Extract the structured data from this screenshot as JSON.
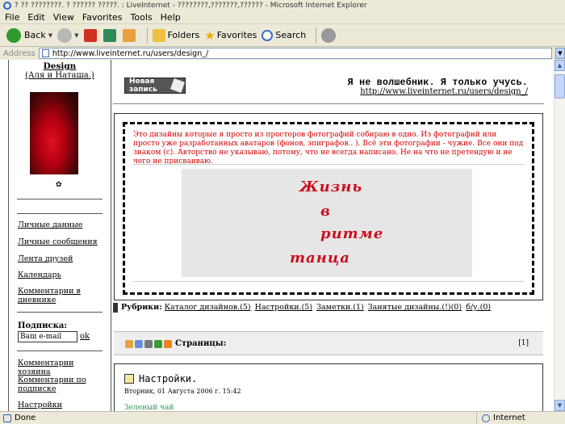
{
  "window": {
    "title": "? ?? ????????. ? ?????? ?????. : LiveInternet - ????????,???????,?????? - Microsoft Internet Explorer"
  },
  "menu": [
    "File",
    "Edit",
    "View",
    "Favorites",
    "Tools",
    "Help"
  ],
  "toolbar": {
    "back": "Back",
    "folders": "Folders",
    "favorites": "Favorites",
    "search": "Search"
  },
  "address": {
    "label": "Address",
    "url": "http://www.liveinternet.ru/users/design_/"
  },
  "sidebar": {
    "title": "Design",
    "authors": "(Аля и Наташа.)",
    "avatar_mark": "✿",
    "links": [
      "Личные данные",
      "Личные сообщения",
      "Лента друзей",
      "Календарь",
      "Комментарии в дневнике"
    ],
    "subscribe_label": "Подписка:",
    "email_value": "Ваш e-mail",
    "ok": "ok",
    "links2": [
      "Комментарии хозяина",
      "Комментарии по подписке",
      "Настройки дневника"
    ]
  },
  "header": {
    "new_post": "Новая запись",
    "motto": "Я не волшебник. Я только учусь.",
    "url": "http://www.liveinternet.ru/users/design_/"
  },
  "post": {
    "intro": "Это дизайны которые я просто из просторов фотографий собираю в одно. Из фотографий или просто уже разработанных аватаров (фонов, эпиграфов.. ). Всё эти фотографии - чужие. Все они под знаком (с). Авторство не указываю, потому, что не всегда написано. Не на что не претендую и не чего не присваиваю.",
    "art_words": [
      "Жизнь",
      "в",
      "ритме",
      "танца"
    ]
  },
  "rubrics": {
    "label": "Рубрики:",
    "items": [
      "Катaлог дизайнов.(5)",
      "Настройки.(5)",
      "Заметки.(1)",
      "Занятые дизайны.(!)(0)",
      "б/у.(0)"
    ]
  },
  "pager": {
    "label": "Страницы:",
    "pages": "[1]"
  },
  "post2": {
    "title": "Настройки.",
    "date": "Вторник, 01 Августа 2006 г. 15:42",
    "tail": "Зеленый чай"
  },
  "status": {
    "left": "Done",
    "zone": "Internet"
  }
}
